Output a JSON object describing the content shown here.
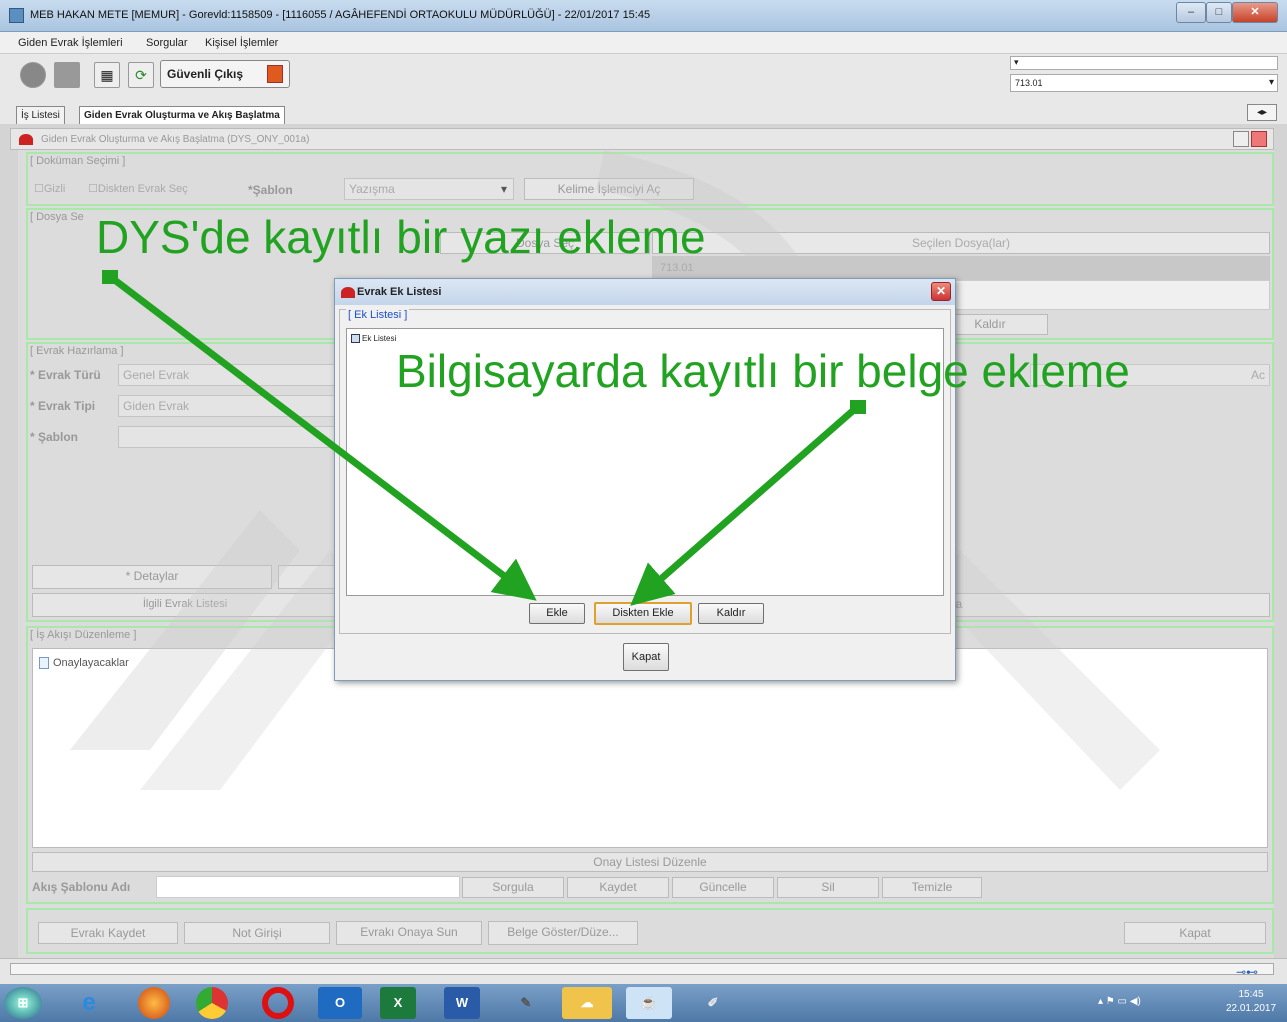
{
  "window": {
    "title": "MEB   HAKAN METE  [MEMUR] - Gorevld:1158509 - [1116055 / AGÂHEFENDİ ORTAOKULU MÜDÜRLÜĞÜ] - 22/01/2017 15:45",
    "min": "–",
    "max": "□",
    "close": "✕"
  },
  "menu": [
    "Giden Evrak İşlemleri",
    "Sorgular",
    "Kişisel İşlemler"
  ],
  "toolbar": {
    "safe_exit": "Güvenli Çıkış",
    "code_value": "713.01"
  },
  "tabs": [
    "İş Listesi",
    "Giden Evrak Oluşturma ve Akış Başlatma"
  ],
  "inner_frame": {
    "title": "Giden Evrak Oluşturma ve Akış Başlatma (DYS_ONY_001a)"
  },
  "doc_select": {
    "legend": "[ Doküman Seçimi ]",
    "chk_gizli": "Gizli",
    "chk_disk": "Diskten Evrak Seç",
    "sablon_label": "*Şablon",
    "sablon_value": "Yazışma",
    "word_btn": "Kelime İşlemciyi Aç"
  },
  "file_select": {
    "legend": "[ Dosya Se",
    "sec_btn": "Dosya Seç",
    "header": "Seçilen Dosya(lar)",
    "row": "713.01",
    "remove": "Kaldır"
  },
  "evrak": {
    "legend": "[ Evrak Hazırlama ]",
    "turu_label": "* Evrak Türü",
    "turu_value": "Genel Evrak",
    "tipi_label": "* Evrak Tipi",
    "tipi_value": "Giden Evrak",
    "sablon_label": "* Şablon",
    "details": "* Detaylar",
    "ilgili": "İlgili Evrak Listesi",
    "right_partial": "Ac",
    "right_partial2": "la"
  },
  "workflow": {
    "legend": "[ İş Akışı Düzenleme ]",
    "tree_node": "Onaylayacaklar",
    "onay_btn": "Onay Listesi Düzenle",
    "akis_label": "Akış Şablonu Adı",
    "buttons": [
      "Sorgula",
      "Kaydet",
      "Güncelle",
      "Sil",
      "Temizle"
    ]
  },
  "bottom_buttons": [
    "Evrakı Kaydet",
    "Not Girişi",
    "Evrakı Onaya Sun",
    "Belge Göster/Düze...",
    "Kapat"
  ],
  "dialog": {
    "title": "Evrak Ek Listesi",
    "legend": "[ Ek Listesi ]",
    "tree_root": "Ek Listesi",
    "btn_ekle": "Ekle",
    "btn_disk": "Diskten Ekle",
    "btn_kaldir": "Kaldır",
    "btn_kapat": "Kapat"
  },
  "annotations": {
    "top": "DYS'de kayıtlı bir yazı ekleme",
    "right": "Bilgisayarda kayıtlı bir belge ekleme"
  },
  "taskbar": {
    "apps": [
      "IE",
      "Firefox",
      "Chrome",
      "Opera",
      "Outlook",
      "Excel",
      "Word",
      "Paint",
      "Cloud",
      "Java",
      "Draw"
    ],
    "time": "15:45",
    "date": "22.01.2017"
  },
  "colors": {
    "annotation": "#21a321",
    "group_border": "#a8e8a8",
    "link_blue": "#1b4fd0"
  }
}
